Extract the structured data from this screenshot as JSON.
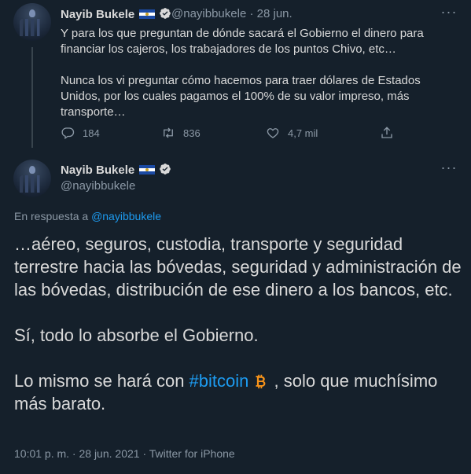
{
  "tweet1": {
    "author_name": "Nayib Bukele",
    "handle": "@nayibbukele",
    "separator": "·",
    "date": "28 jun.",
    "paragraph1": "Y para los que preguntan de dónde sacará el Gobierno el dinero para financiar los cajeros, los trabajadores de los puntos Chivo, etc…",
    "paragraph2": "Nunca los vi preguntar cómo hacemos para traer dólares de Estados Unidos, por los cuales pagamos el 100% de su valor impreso, más transporte…",
    "replies": "184",
    "retweets": "836",
    "likes": "4,7 mil"
  },
  "tweet2": {
    "author_name": "Nayib Bukele",
    "handle": "@nayibbukele",
    "reply_prefix": "En respuesta a",
    "reply_to": "@nayibbukele",
    "paragraph1": "…aéreo, seguros, custodia, transporte y seguridad terrestre hacia las bóvedas, seguridad y administración de las bóvedas, distribución de ese dinero a los bancos, etc.",
    "paragraph2": "Sí, todo lo absorbe el Gobierno.",
    "paragraph3_before": "Lo mismo se hará con ",
    "hashtag": "#bitcoin",
    "paragraph3_after": " , solo que muchísimo más barato.",
    "metadata": "10:01 p. m. · 28 jun. 2021 · Twitter for iPhone"
  },
  "icons": {
    "verified": "verified-badge-icon",
    "flag": "el-salvador-flag-icon",
    "more": "more-options-icon",
    "reply": "reply-icon",
    "retweet": "retweet-icon",
    "like": "like-icon",
    "share": "share-icon",
    "bitcoin": "bitcoin-emoji-icon"
  },
  "colors": {
    "background": "#15202b",
    "text": "#d9d9d9",
    "muted": "#8b98a5",
    "link": "#1d9bf0",
    "verified": "#d9d9d9",
    "bitcoin": "#f7931a"
  }
}
